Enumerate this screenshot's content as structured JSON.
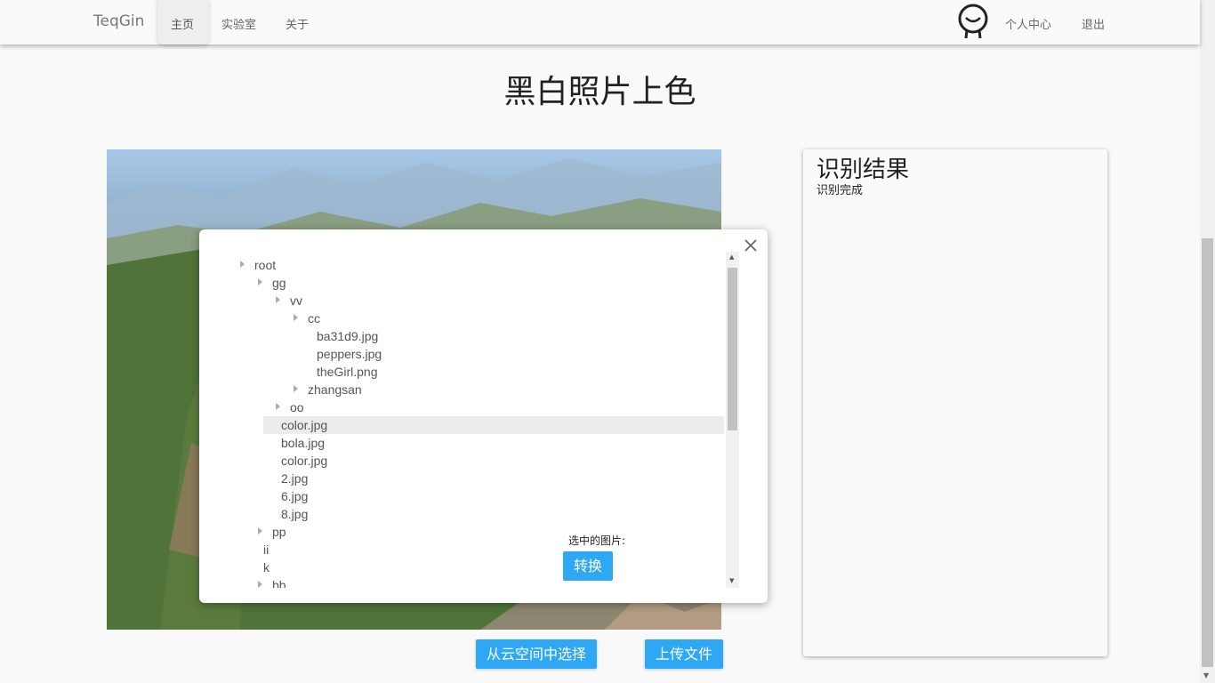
{
  "navbar": {
    "brand": "TeqGin",
    "items": [
      {
        "label": "主页"
      },
      {
        "label": "实验室"
      },
      {
        "label": "关于"
      }
    ],
    "profile_label": "个人中心",
    "logout_label": "退出",
    "avatar_icon": "smiley-face-icon"
  },
  "page": {
    "title": "黑白照片上色"
  },
  "result": {
    "title": "识别结果",
    "status": "识别完成"
  },
  "actions": {
    "cloud_label": "从云空间中选择",
    "upload_label": "上传文件"
  },
  "dialog": {
    "tree": [
      {
        "label": "root",
        "level": 0,
        "folder": true
      },
      {
        "label": "gg",
        "level": 1,
        "folder": true
      },
      {
        "label": "vv",
        "level": 2,
        "folder": true
      },
      {
        "label": "cc",
        "level": 3,
        "folder": true
      },
      {
        "label": "ba31d9.jpg",
        "level": 4,
        "folder": false
      },
      {
        "label": "peppers.jpg",
        "level": 4,
        "folder": false
      },
      {
        "label": "theGirl.png",
        "level": 4,
        "folder": false
      },
      {
        "label": "zhangsan",
        "level": 3,
        "folder": true
      },
      {
        "label": "oo",
        "level": 2,
        "folder": true
      },
      {
        "label": "color.jpg",
        "level": 2,
        "folder": false,
        "selected": true
      },
      {
        "label": "bola.jpg",
        "level": 2,
        "folder": false
      },
      {
        "label": "color.jpg",
        "level": 2,
        "folder": false
      },
      {
        "label": "2.jpg",
        "level": 2,
        "folder": false
      },
      {
        "label": "6.jpg",
        "level": 2,
        "folder": false
      },
      {
        "label": "8.jpg",
        "level": 2,
        "folder": false
      },
      {
        "label": "pp",
        "level": 1,
        "folder": true
      },
      {
        "label": "ii",
        "level": 1,
        "folder": false
      },
      {
        "label": "k",
        "level": 1,
        "folder": false
      },
      {
        "label": "bb",
        "level": 1,
        "folder": true
      }
    ],
    "selected_label": "选中的图片:",
    "convert_label": "转换",
    "close_icon": "close-icon"
  },
  "colors": {
    "accent": "#2ea7f4"
  }
}
